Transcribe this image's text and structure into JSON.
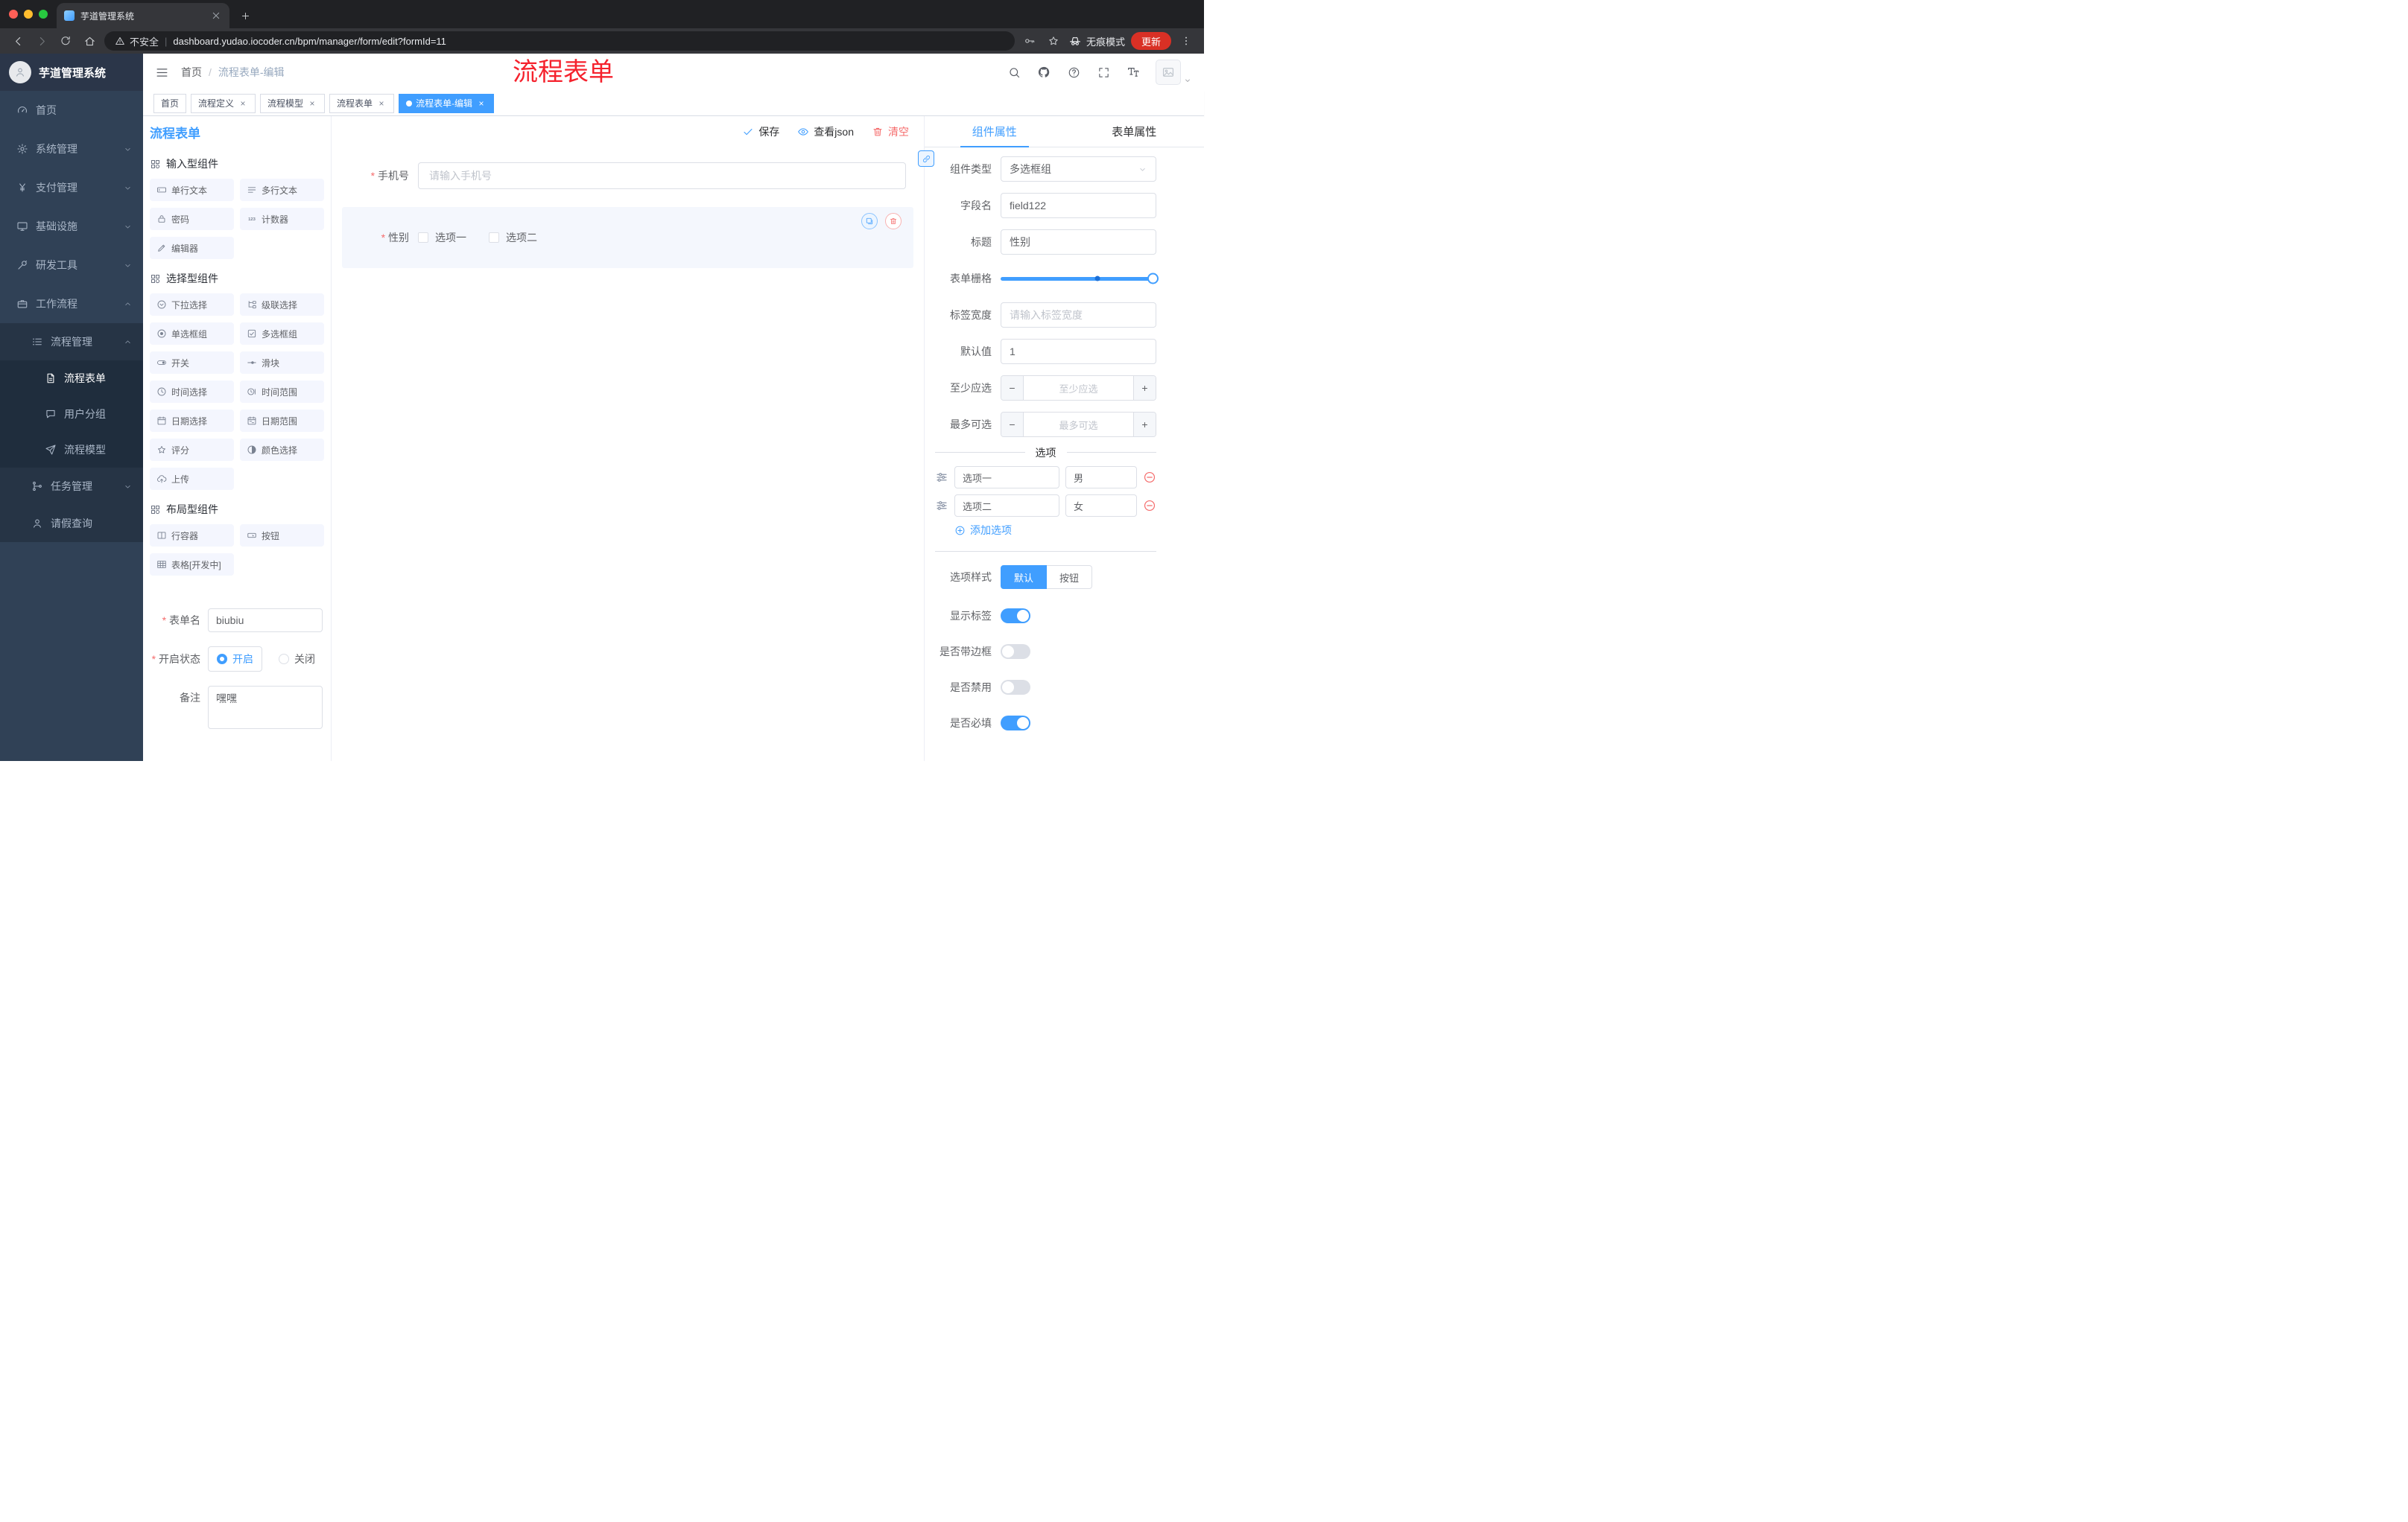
{
  "colors": {
    "accent": "#409EFF",
    "danger": "#F56C6C",
    "annotation_red": "#F5222D",
    "sidebar_bg": "#304156",
    "active_tag": "#409EFF"
  },
  "browser": {
    "tab_title": "芋道管理系统",
    "security_label": "不安全",
    "url": "dashboard.yudao.iocoder.cn/bpm/manager/form/edit?formId=11",
    "incognito_label": "无痕模式",
    "update_label": "更新"
  },
  "annotation": "流程表单",
  "sidebar": {
    "logo_title": "芋道管理系统",
    "items": [
      {
        "label": "首页"
      },
      {
        "label": "系统管理"
      },
      {
        "label": "支付管理"
      },
      {
        "label": "基础设施"
      },
      {
        "label": "研发工具"
      },
      {
        "label": "工作流程"
      },
      {
        "label": "流程管理"
      },
      {
        "label": "流程表单"
      },
      {
        "label": "用户分组"
      },
      {
        "label": "流程模型"
      },
      {
        "label": "任务管理"
      },
      {
        "label": "请假查询"
      }
    ]
  },
  "breadcrumb": {
    "root": "首页",
    "current": "流程表单-编辑"
  },
  "tags": [
    {
      "label": "首页"
    },
    {
      "label": "流程定义"
    },
    {
      "label": "流程模型"
    },
    {
      "label": "流程表单"
    },
    {
      "label": "流程表单-编辑"
    }
  ],
  "designer": {
    "panel_title": "流程表单",
    "actions": {
      "save": "保存",
      "view_json": "查看json",
      "clear": "清空"
    },
    "palette": {
      "sections": [
        {
          "title": "输入型组件",
          "items": [
            {
              "label": "单行文本"
            },
            {
              "label": "多行文本"
            },
            {
              "label": "密码"
            },
            {
              "label": "计数器"
            },
            {
              "label": "编辑器"
            }
          ]
        },
        {
          "title": "选择型组件",
          "items": [
            {
              "label": "下拉选择"
            },
            {
              "label": "级联选择"
            },
            {
              "label": "单选框组"
            },
            {
              "label": "多选框组"
            },
            {
              "label": "开关"
            },
            {
              "label": "滑块"
            },
            {
              "label": "时间选择"
            },
            {
              "label": "时间范围"
            },
            {
              "label": "日期选择"
            },
            {
              "label": "日期范围"
            },
            {
              "label": "评分"
            },
            {
              "label": "颜色选择"
            },
            {
              "label": "上传"
            }
          ]
        },
        {
          "title": "布局型组件",
          "items": [
            {
              "label": "行容器"
            },
            {
              "label": "按钮"
            },
            {
              "label": "表格[开发中]"
            }
          ]
        }
      ]
    },
    "form_meta": {
      "name_label": "表单名",
      "name_value": "biubiu",
      "status_label": "开启状态",
      "status_on": "开启",
      "status_off": "关闭",
      "remark_label": "备注",
      "remark_value": "嘿嘿"
    },
    "canvas": {
      "phone_label": "手机号",
      "phone_placeholder": "请输入手机号",
      "gender_label": "性别",
      "gender_options": [
        "选项一",
        "选项二"
      ]
    },
    "props": {
      "tab_component": "组件属性",
      "tab_form": "表单属性",
      "rows": {
        "type_label": "组件类型",
        "type_value": "多选框组",
        "field_label": "字段名",
        "field_value": "field122",
        "title_label": "标题",
        "title_value": "性别",
        "grid_label": "表单栅格",
        "width_label": "标签宽度",
        "width_placeholder": "请输入标签宽度",
        "default_label": "默认值",
        "default_value": "1",
        "min_label": "至少应选",
        "min_placeholder": "至少应选",
        "max_label": "最多可选",
        "max_placeholder": "最多可选"
      },
      "options": {
        "divider_label": "选项",
        "rows": [
          {
            "name": "选项一",
            "value": "男"
          },
          {
            "name": "选项二",
            "value": "女"
          }
        ],
        "add_label": "添加选项"
      },
      "style": {
        "label": "选项样式",
        "options": [
          "默认",
          "按钮"
        ],
        "selected": "默认"
      },
      "toggles": [
        {
          "label": "显示标签",
          "on": true
        },
        {
          "label": "是否带边框",
          "on": false
        },
        {
          "label": "是否禁用",
          "on": false
        },
        {
          "label": "是否必填",
          "on": true
        }
      ]
    }
  }
}
